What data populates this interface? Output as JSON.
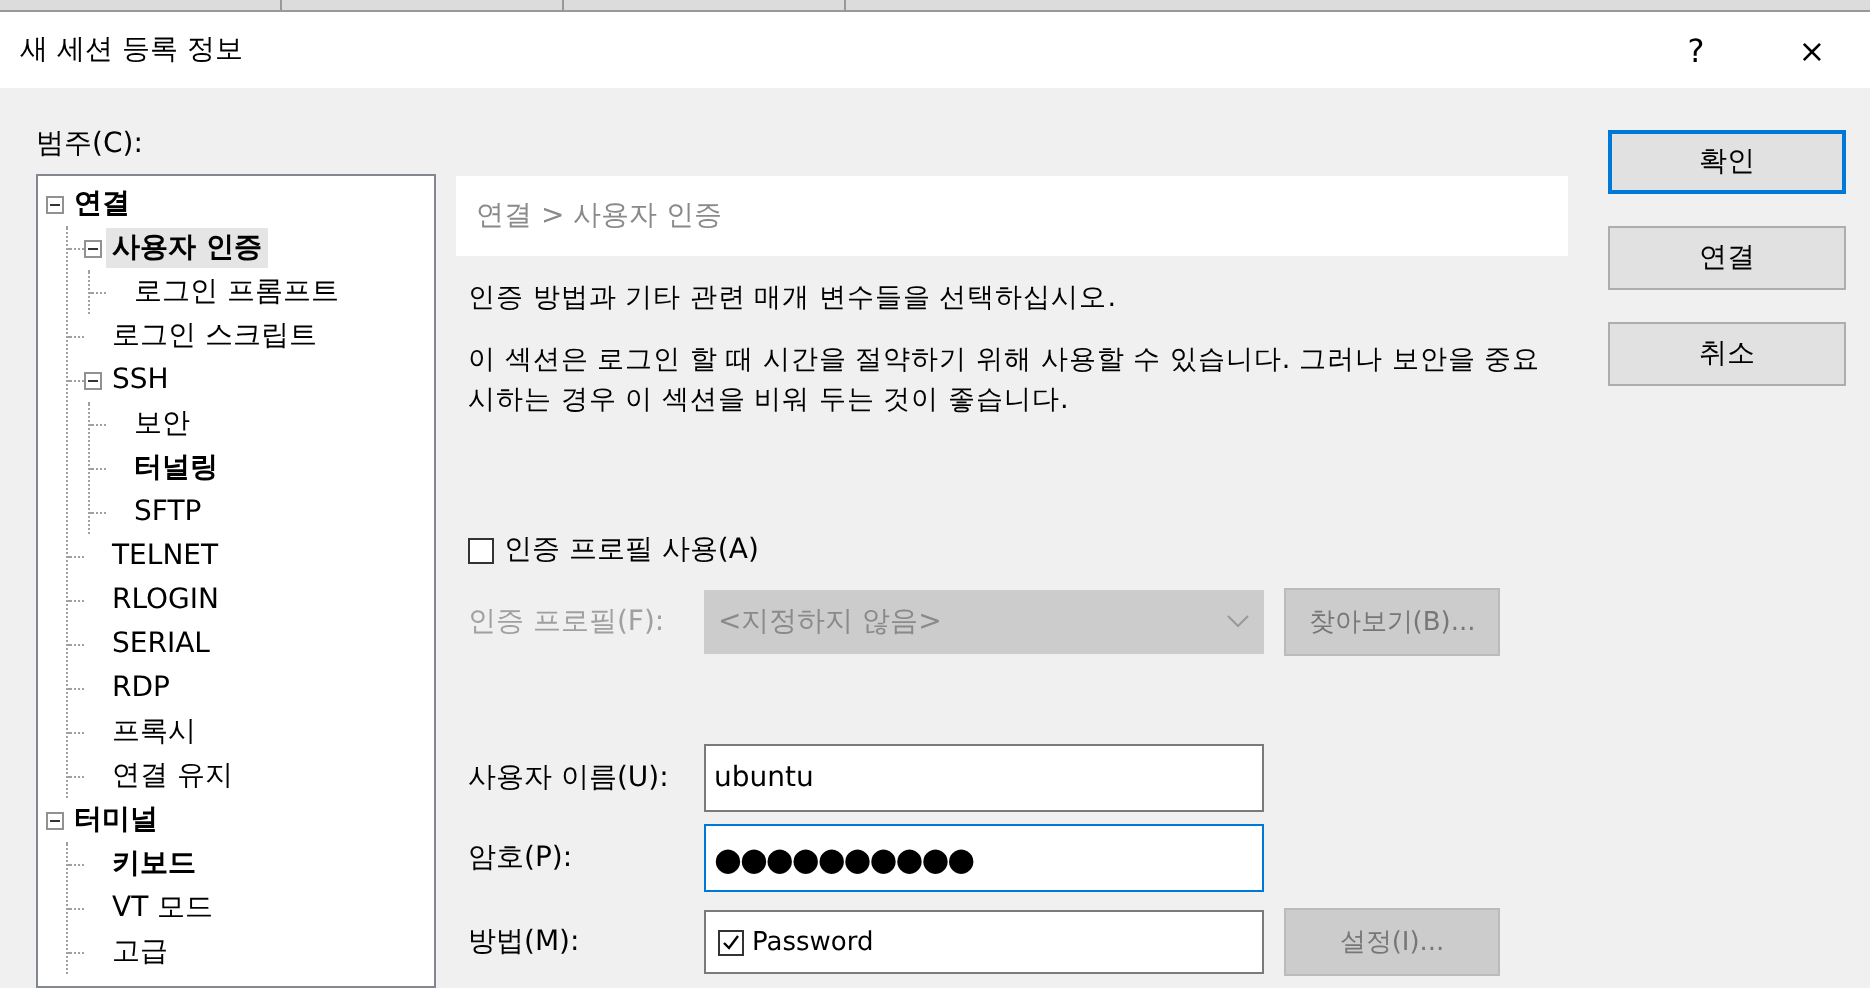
{
  "window": {
    "title": "새 세션 등록 정보",
    "help": "?",
    "close": "×"
  },
  "category_label": "범주(C):",
  "tree": [
    {
      "label": "연결",
      "bold": true,
      "selected": false,
      "expanded": true,
      "children": [
        {
          "label": "사용자 인증",
          "bold": true,
          "selected": true,
          "expanded": true,
          "children": [
            {
              "label": "로그인 프롬프트",
              "bold": false,
              "selected": false
            }
          ]
        },
        {
          "label": "로그인 스크립트",
          "bold": false,
          "selected": false
        },
        {
          "label": "SSH",
          "bold": false,
          "selected": false,
          "expanded": true,
          "children": [
            {
              "label": "보안",
              "bold": false,
              "selected": false
            },
            {
              "label": "터널링",
              "bold": true,
              "selected": false
            },
            {
              "label": "SFTP",
              "bold": false,
              "selected": false
            }
          ]
        },
        {
          "label": "TELNET",
          "bold": false,
          "selected": false
        },
        {
          "label": "RLOGIN",
          "bold": false,
          "selected": false
        },
        {
          "label": "SERIAL",
          "bold": false,
          "selected": false
        },
        {
          "label": "RDP",
          "bold": false,
          "selected": false
        },
        {
          "label": "프록시",
          "bold": false,
          "selected": false
        },
        {
          "label": "연결 유지",
          "bold": false,
          "selected": false
        }
      ]
    },
    {
      "label": "터미널",
      "bold": true,
      "selected": false,
      "expanded": true,
      "children": [
        {
          "label": "키보드",
          "bold": true,
          "selected": false
        },
        {
          "label": "VT 모드",
          "bold": false,
          "selected": false
        },
        {
          "label": "고급",
          "bold": false,
          "selected": false
        }
      ]
    }
  ],
  "breadcrumb": "연결 > 사용자 인증",
  "description": "인증 방법과 기타 관련 매개 변수들을 선택하십시오.",
  "note": "이 섹션은 로그인 할 때 시간을 절약하기 위해 사용할 수 있습니다. 그러나 보안을 중요시하는 경우 이 섹션을 비워 두는 것이 좋습니다.",
  "use_profile": {
    "label": "인증 프로필 사용(A)",
    "checked": false
  },
  "profile": {
    "label": "인증 프로필(F):",
    "value": "<지정하지 않음>",
    "disabled": true,
    "browse": "찾아보기(B)..."
  },
  "username": {
    "label": "사용자 이름(U):",
    "value": "ubuntu"
  },
  "password": {
    "label": "암호(P):",
    "value": "●●●●●●●●●●",
    "focused": true
  },
  "method": {
    "label": "방법(M):",
    "items": [
      {
        "label": "Password",
        "checked": true
      }
    ],
    "settings": "설정(I)...",
    "settings_disabled": true
  },
  "buttons": [
    {
      "label": "확인",
      "default": true
    },
    {
      "label": "연결",
      "default": false
    },
    {
      "label": "취소",
      "default": false
    }
  ]
}
